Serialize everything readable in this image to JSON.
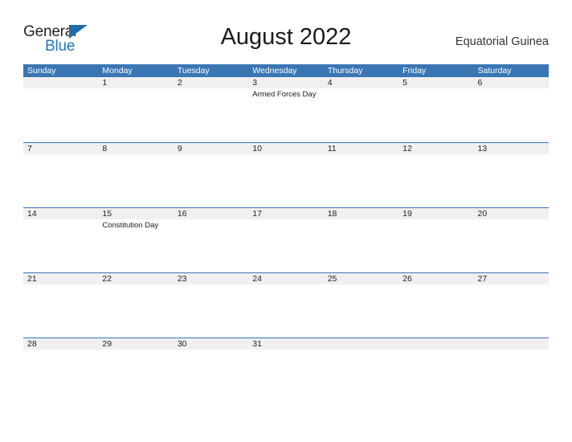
{
  "logo": {
    "word_top": "General",
    "word_bottom": "Blue",
    "flag_icon": "triangle-flag-icon",
    "color_dark": "#231f20",
    "color_blue": "#1c79c0"
  },
  "header": {
    "title": "August 2022",
    "country": "Equatorial Guinea"
  },
  "theme": {
    "header_blue": "#3a76b4",
    "row_band_gray": "#f0f0f0",
    "rule_blue": "#3a76b4",
    "text_dark": "#222222"
  },
  "calendar": {
    "weekday_headers": [
      "Sunday",
      "Monday",
      "Tuesday",
      "Wednesday",
      "Thursday",
      "Friday",
      "Saturday"
    ],
    "weeks": [
      {
        "days": [
          {
            "num": "",
            "event": ""
          },
          {
            "num": "1",
            "event": ""
          },
          {
            "num": "2",
            "event": ""
          },
          {
            "num": "3",
            "event": "Armed Forces Day"
          },
          {
            "num": "4",
            "event": ""
          },
          {
            "num": "5",
            "event": ""
          },
          {
            "num": "6",
            "event": ""
          }
        ]
      },
      {
        "days": [
          {
            "num": "7",
            "event": ""
          },
          {
            "num": "8",
            "event": ""
          },
          {
            "num": "9",
            "event": ""
          },
          {
            "num": "10",
            "event": ""
          },
          {
            "num": "11",
            "event": ""
          },
          {
            "num": "12",
            "event": ""
          },
          {
            "num": "13",
            "event": ""
          }
        ]
      },
      {
        "days": [
          {
            "num": "14",
            "event": ""
          },
          {
            "num": "15",
            "event": "Constitution Day"
          },
          {
            "num": "16",
            "event": ""
          },
          {
            "num": "17",
            "event": ""
          },
          {
            "num": "18",
            "event": ""
          },
          {
            "num": "19",
            "event": ""
          },
          {
            "num": "20",
            "event": ""
          }
        ]
      },
      {
        "days": [
          {
            "num": "21",
            "event": ""
          },
          {
            "num": "22",
            "event": ""
          },
          {
            "num": "23",
            "event": ""
          },
          {
            "num": "24",
            "event": ""
          },
          {
            "num": "25",
            "event": ""
          },
          {
            "num": "26",
            "event": ""
          },
          {
            "num": "27",
            "event": ""
          }
        ]
      },
      {
        "days": [
          {
            "num": "28",
            "event": ""
          },
          {
            "num": "29",
            "event": ""
          },
          {
            "num": "30",
            "event": ""
          },
          {
            "num": "31",
            "event": ""
          },
          {
            "num": "",
            "event": ""
          },
          {
            "num": "",
            "event": ""
          },
          {
            "num": "",
            "event": ""
          }
        ]
      }
    ]
  }
}
